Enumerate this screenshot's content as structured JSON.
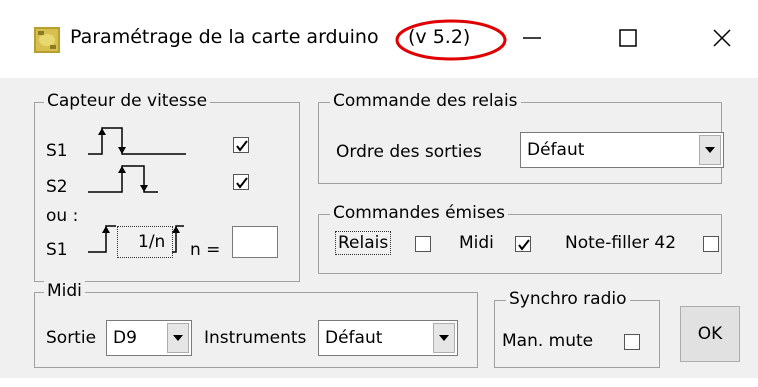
{
  "window": {
    "title": "Paramétrage de la carte arduino",
    "version": "(v 5.2)",
    "icons": {
      "app": "arduino-card-icon",
      "minimize": "minimize-icon",
      "maximize": "maximize-icon",
      "close": "close-icon"
    },
    "annotation_color": "#e00000"
  },
  "capteur": {
    "legend": "Capteur de vitesse",
    "s1_label": "S1",
    "s2_label": "S2",
    "ou_label": "ou :",
    "s1b_label": "S1",
    "divider_label": "1/n",
    "n_label": "n =",
    "n_value": "",
    "s1_checked": true,
    "s2_checked": true
  },
  "relais": {
    "legend": "Commande des relais",
    "order_label": "Ordre des sorties",
    "order_value": "Défaut"
  },
  "emises": {
    "legend": "Commandes émises",
    "relais_label": "Relais",
    "relais_checked": false,
    "midi_label": "Midi",
    "midi_checked": true,
    "note_label": "Note-filler 42",
    "note_checked": false
  },
  "midi": {
    "legend": "Midi",
    "sortie_label": "Sortie",
    "sortie_value": "D9",
    "instruments_label": "Instruments",
    "instruments_value": "Défaut"
  },
  "synchro": {
    "legend": "Synchro radio",
    "mute_label": "Man. mute",
    "mute_checked": false
  },
  "ok_label": "OK"
}
